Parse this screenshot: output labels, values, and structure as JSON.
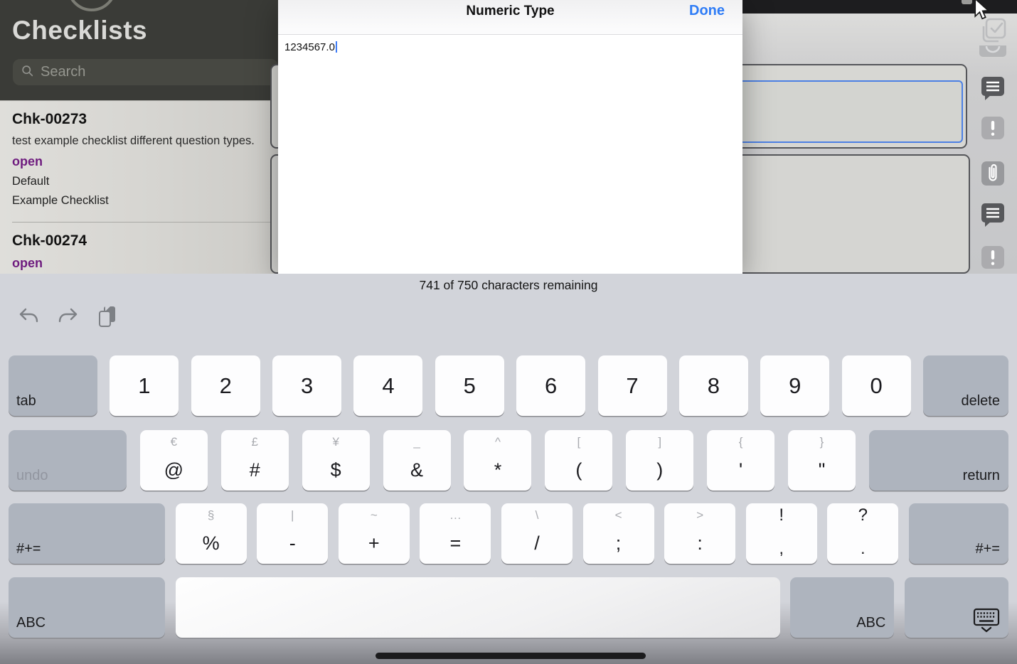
{
  "sidebar": {
    "title": "Checklists",
    "search_placeholder": "Search",
    "status_color": "#6e1b7e",
    "items": [
      {
        "id": "Chk-00273",
        "description": "test example checklist different question types.",
        "status": "open",
        "lines": [
          "Default",
          "Example Checklist"
        ]
      },
      {
        "id": "Chk-00274",
        "description": "",
        "status": "open",
        "lines": []
      }
    ]
  },
  "modal": {
    "title": "Numeric Type",
    "done_label": "Done",
    "field_value": "1234567.0",
    "accent_color": "#2e7cf6"
  },
  "content": {
    "rail_icons": [
      "submit-checklist-icon",
      "clock-icon",
      "comment-icon",
      "alert-icon",
      "attachment-icon",
      "comment-icon",
      "alert-icon"
    ]
  },
  "keyboard": {
    "char_counter": "741 of 750 characters remaining",
    "toolbar_icons": [
      "undo-icon",
      "redo-icon",
      "paste-icon"
    ],
    "rows": [
      {
        "keys": [
          {
            "role": "tab",
            "label": "tab"
          },
          {
            "main": "1"
          },
          {
            "main": "2"
          },
          {
            "main": "3"
          },
          {
            "main": "4"
          },
          {
            "main": "5"
          },
          {
            "main": "6"
          },
          {
            "main": "7"
          },
          {
            "main": "8"
          },
          {
            "main": "9"
          },
          {
            "main": "0"
          },
          {
            "role": "delete",
            "label": "delete"
          }
        ]
      },
      {
        "keys": [
          {
            "role": "undo",
            "label": "undo"
          },
          {
            "top": "€",
            "main": "@"
          },
          {
            "top": "£",
            "main": "#"
          },
          {
            "top": "¥",
            "main": "$"
          },
          {
            "top": "_",
            "main": "&"
          },
          {
            "top": "^",
            "main": "*"
          },
          {
            "top": "[",
            "main": "("
          },
          {
            "top": "]",
            "main": ")"
          },
          {
            "top": "{",
            "main": "'"
          },
          {
            "top": "}",
            "main": "\""
          },
          {
            "role": "return",
            "label": "return"
          }
        ]
      },
      {
        "keys": [
          {
            "role": "sym-left",
            "label": "#+="
          },
          {
            "top": "§",
            "main": "%"
          },
          {
            "top": "|",
            "main": "-"
          },
          {
            "top": "~",
            "main": "+"
          },
          {
            "top": "…",
            "main": "="
          },
          {
            "top": "\\",
            "main": "/"
          },
          {
            "top": "<",
            "main": ";"
          },
          {
            "top": ">",
            "main": ":"
          },
          {
            "top": "!",
            "main": ",",
            "top_dark": true
          },
          {
            "top": "?",
            "main": ".",
            "top_dark": true
          },
          {
            "role": "sym-right",
            "label": "#+="
          }
        ]
      },
      {
        "keys": [
          {
            "role": "abc-left",
            "label": "ABC"
          },
          {
            "role": "space"
          },
          {
            "role": "abc-right",
            "label": "ABC"
          },
          {
            "role": "dismiss",
            "icon": "keyboard-dismiss-icon"
          }
        ]
      }
    ]
  }
}
